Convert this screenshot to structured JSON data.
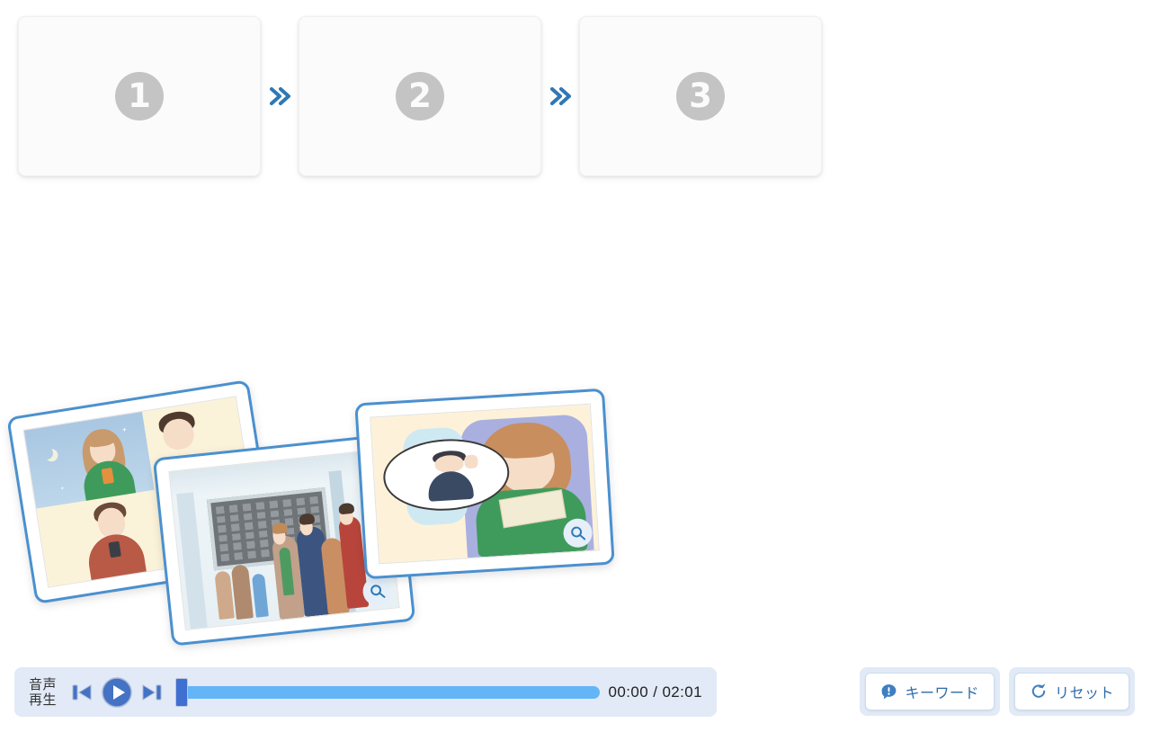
{
  "dropzones": {
    "items": [
      {
        "number": "1",
        "icon": "circled-number-one"
      },
      {
        "number": "2",
        "icon": "circled-number-two"
      },
      {
        "number": "3",
        "icon": "circled-number-three"
      }
    ],
    "separator_icon": "double-chevron-right-icon",
    "accent_color": "#2e78b5",
    "number_color": "#c4c4c4"
  },
  "cards": [
    {
      "id": "card-1",
      "alt": "Split-panel illustration: woman in green sweater looking at phone under a night sky with a crescent moon, and a man in a red sweater looking at his phone",
      "zoom_icon": "magnifier-icon"
    },
    {
      "id": "card-2",
      "alt": "Illustration of a crowded train station concourse with a large departure board and travellers with luggage",
      "zoom_icon": "magnifier-icon"
    },
    {
      "id": "card-3",
      "alt": "Illustration of a woman in a green sweater sitting in a train seat holding a letter, thinking of a boy waving",
      "zoom_icon": "magnifier-icon"
    }
  ],
  "player": {
    "label_line1": "音声",
    "label_line2": "再生",
    "prev_icon": "skip-previous-icon",
    "play_icon": "play-circle-icon",
    "next_icon": "skip-next-icon",
    "progress_percent": 0,
    "current_time": "00:00",
    "duration": "02:01",
    "time_display": "00:00 / 02:01",
    "bar_color": "#e1eaf6",
    "track_color": "#64b5f6",
    "thumb_color": "#3f6fd1",
    "control_color": "#4472c4"
  },
  "actions": [
    {
      "label": "キーワード",
      "icon": "exclamation-bubble-icon",
      "name": "keyword-button"
    },
    {
      "label": "リセット",
      "icon": "rotate-refresh-icon",
      "name": "reset-button"
    }
  ],
  "theme": {
    "background": "#ffffff",
    "accent": "#2e78b5",
    "card_border": "#4a90cf"
  }
}
